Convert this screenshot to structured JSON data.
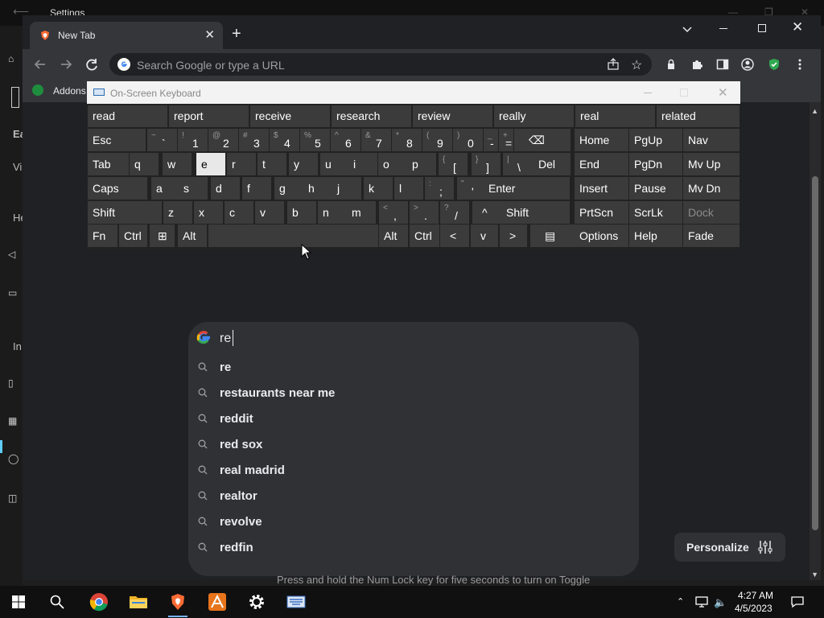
{
  "settings": {
    "title": "Settings",
    "side_labels": [
      "Ea",
      "Vi",
      "He",
      "In"
    ]
  },
  "browser": {
    "tab": {
      "title": "New Tab"
    },
    "omnibox": {
      "placeholder": "Search Google or type a URL"
    },
    "bookmarks": [
      {
        "label": "Addons"
      }
    ],
    "search": {
      "query": "re",
      "suggestions": [
        "re",
        "restaurants near me",
        "reddit",
        "red sox",
        "real madrid",
        "realtor",
        "revolve",
        "redfin"
      ]
    },
    "personalize_label": "Personalize",
    "footer_text": "Press and hold the Num Lock key for five seconds to turn on Toggle"
  },
  "osk": {
    "title": "On-Screen Keyboard",
    "predictions": [
      "read",
      "report",
      "receive",
      "research",
      "review",
      "really",
      "real",
      "related"
    ],
    "rows": [
      [
        {
          "l": "Esc"
        },
        {
          "s": "~",
          "m": "`"
        },
        {
          "s": "!",
          "m": "1"
        },
        {
          "s": "@",
          "m": "2"
        },
        {
          "s": "#",
          "m": "3"
        },
        {
          "s": "$",
          "m": "4"
        },
        {
          "s": "%",
          "m": "5"
        },
        {
          "s": "^",
          "m": "6"
        },
        {
          "s": "&",
          "m": "7"
        },
        {
          "s": "*",
          "m": "8"
        },
        {
          "s": "(",
          "m": "9"
        },
        {
          "s": ")",
          "m": "0"
        },
        {
          "s": "_",
          "m": "-"
        },
        {
          "s": "+",
          "m": "="
        },
        {
          "l": "⌫"
        },
        {
          "l": "Home"
        },
        {
          "l": "PgUp"
        },
        {
          "l": "Nav"
        }
      ],
      [
        {
          "l": "Tab"
        },
        {
          "l": "q"
        },
        {
          "l": "w"
        },
        {
          "l": "e"
        },
        {
          "l": "r"
        },
        {
          "l": "t"
        },
        {
          "l": "y"
        },
        {
          "l": "u"
        },
        {
          "l": "i"
        },
        {
          "l": "o"
        },
        {
          "l": "p"
        },
        {
          "s": "{",
          "m": "["
        },
        {
          "s": "}",
          "m": "]"
        },
        {
          "s": "|",
          "m": "\\"
        },
        {
          "l": "Del"
        },
        {
          "l": "End"
        },
        {
          "l": "PgDn"
        },
        {
          "l": "Mv Up"
        }
      ],
      [
        {
          "l": "Caps"
        },
        {
          "l": "a"
        },
        {
          "l": "s"
        },
        {
          "l": "d"
        },
        {
          "l": "f"
        },
        {
          "l": "g"
        },
        {
          "l": "h"
        },
        {
          "l": "j"
        },
        {
          "l": "k"
        },
        {
          "l": "l"
        },
        {
          "s": ":",
          "m": ";"
        },
        {
          "s": "\"",
          "m": "'"
        },
        {
          "l": "Enter"
        },
        {
          "l": "Insert"
        },
        {
          "l": "Pause"
        },
        {
          "l": "Mv Dn"
        }
      ],
      [
        {
          "l": "Shift"
        },
        {
          "l": "z"
        },
        {
          "l": "x"
        },
        {
          "l": "c"
        },
        {
          "l": "v"
        },
        {
          "l": "b"
        },
        {
          "l": "n"
        },
        {
          "l": "m"
        },
        {
          "s": "<",
          "m": ","
        },
        {
          "s": ">",
          "m": "."
        },
        {
          "s": "?",
          "m": "/"
        },
        {
          "l": "^"
        },
        {
          "l": "Shift"
        },
        {
          "l": "PrtScn"
        },
        {
          "l": "ScrLk"
        },
        {
          "l": "Dock"
        }
      ],
      [
        {
          "l": "Fn"
        },
        {
          "l": "Ctrl"
        },
        {
          "l": "⊞"
        },
        {
          "l": "Alt"
        },
        {
          "l": ""
        },
        {
          "l": "Alt"
        },
        {
          "l": "Ctrl"
        },
        {
          "l": "<"
        },
        {
          "l": "v"
        },
        {
          "l": ">"
        },
        {
          "l": "▤"
        },
        {
          "l": "Options"
        },
        {
          "l": "Help"
        },
        {
          "l": "Fade"
        }
      ]
    ]
  },
  "taskbar": {
    "time": "4:27 AM",
    "date": "4/5/2023"
  },
  "colors": {
    "accent": "#60cdff",
    "key_bg": "#3b3b3b",
    "key_active": "#e8e8e8",
    "ntp_bg": "#202124",
    "search_bg": "#303134"
  }
}
